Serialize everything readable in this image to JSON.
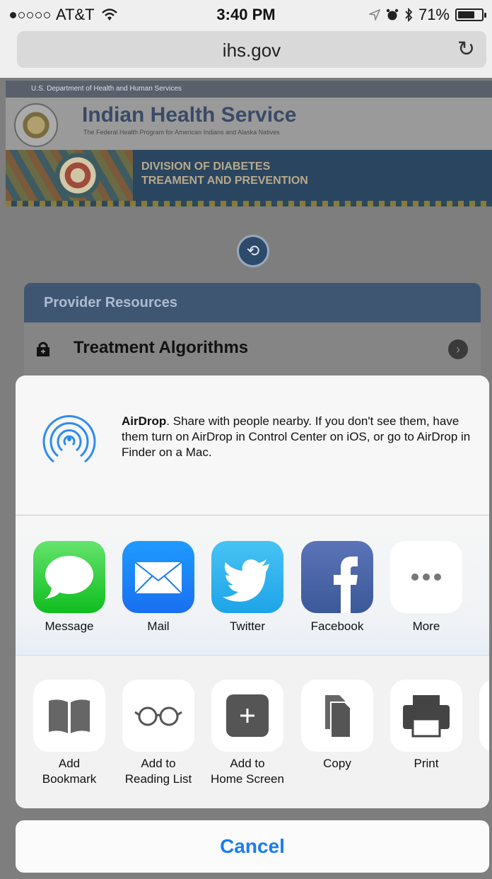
{
  "status_bar": {
    "carrier": "AT&T",
    "time": "3:40 PM",
    "battery": "71%",
    "battery_level": 0.71
  },
  "address_bar": {
    "url": "ihs.gov"
  },
  "webpage": {
    "department": "U.S. Department of Health and Human Services",
    "site_title": "Indian Health Service",
    "site_subtitle": "The Federal Health Program for American Indians and Alaska Natives",
    "banner_line1": "DIVISION OF DIABETES",
    "banner_line2": "TREAMENT AND PREVENTION",
    "panel_header": "Provider Resources",
    "row_label": "Treatment Algorithms"
  },
  "share_sheet": {
    "airdrop_title": "AirDrop",
    "airdrop_text": ". Share with people nearby. If you don't see them, have them turn on AirDrop in Control Center on iOS, or go to AirDrop in Finder on a Mac.",
    "apps": [
      {
        "label": "Message",
        "icon": "message-icon"
      },
      {
        "label": "Mail",
        "icon": "mail-icon"
      },
      {
        "label": "Twitter",
        "icon": "twitter-icon"
      },
      {
        "label": "Facebook",
        "icon": "facebook-icon"
      },
      {
        "label": "More",
        "icon": "more-icon"
      }
    ],
    "actions": [
      {
        "label_line1": "Add",
        "label_line2": "Bookmark",
        "icon": "bookmark-icon"
      },
      {
        "label_line1": "Add to",
        "label_line2": "Reading List",
        "icon": "reading-list-icon"
      },
      {
        "label_line1": "Add to",
        "label_line2": "Home Screen",
        "icon": "add-home-screen-icon"
      },
      {
        "label_line1": "Copy",
        "label_line2": "",
        "icon": "copy-icon"
      },
      {
        "label_line1": "Print",
        "label_line2": "",
        "icon": "print-icon"
      }
    ],
    "cancel_label": "Cancel"
  },
  "colors": {
    "accent_blue": "#1a7cf0",
    "messages_green": "#0fbd1e",
    "facebook_blue": "#3b5998",
    "twitter_blue": "#1ea4e8"
  }
}
